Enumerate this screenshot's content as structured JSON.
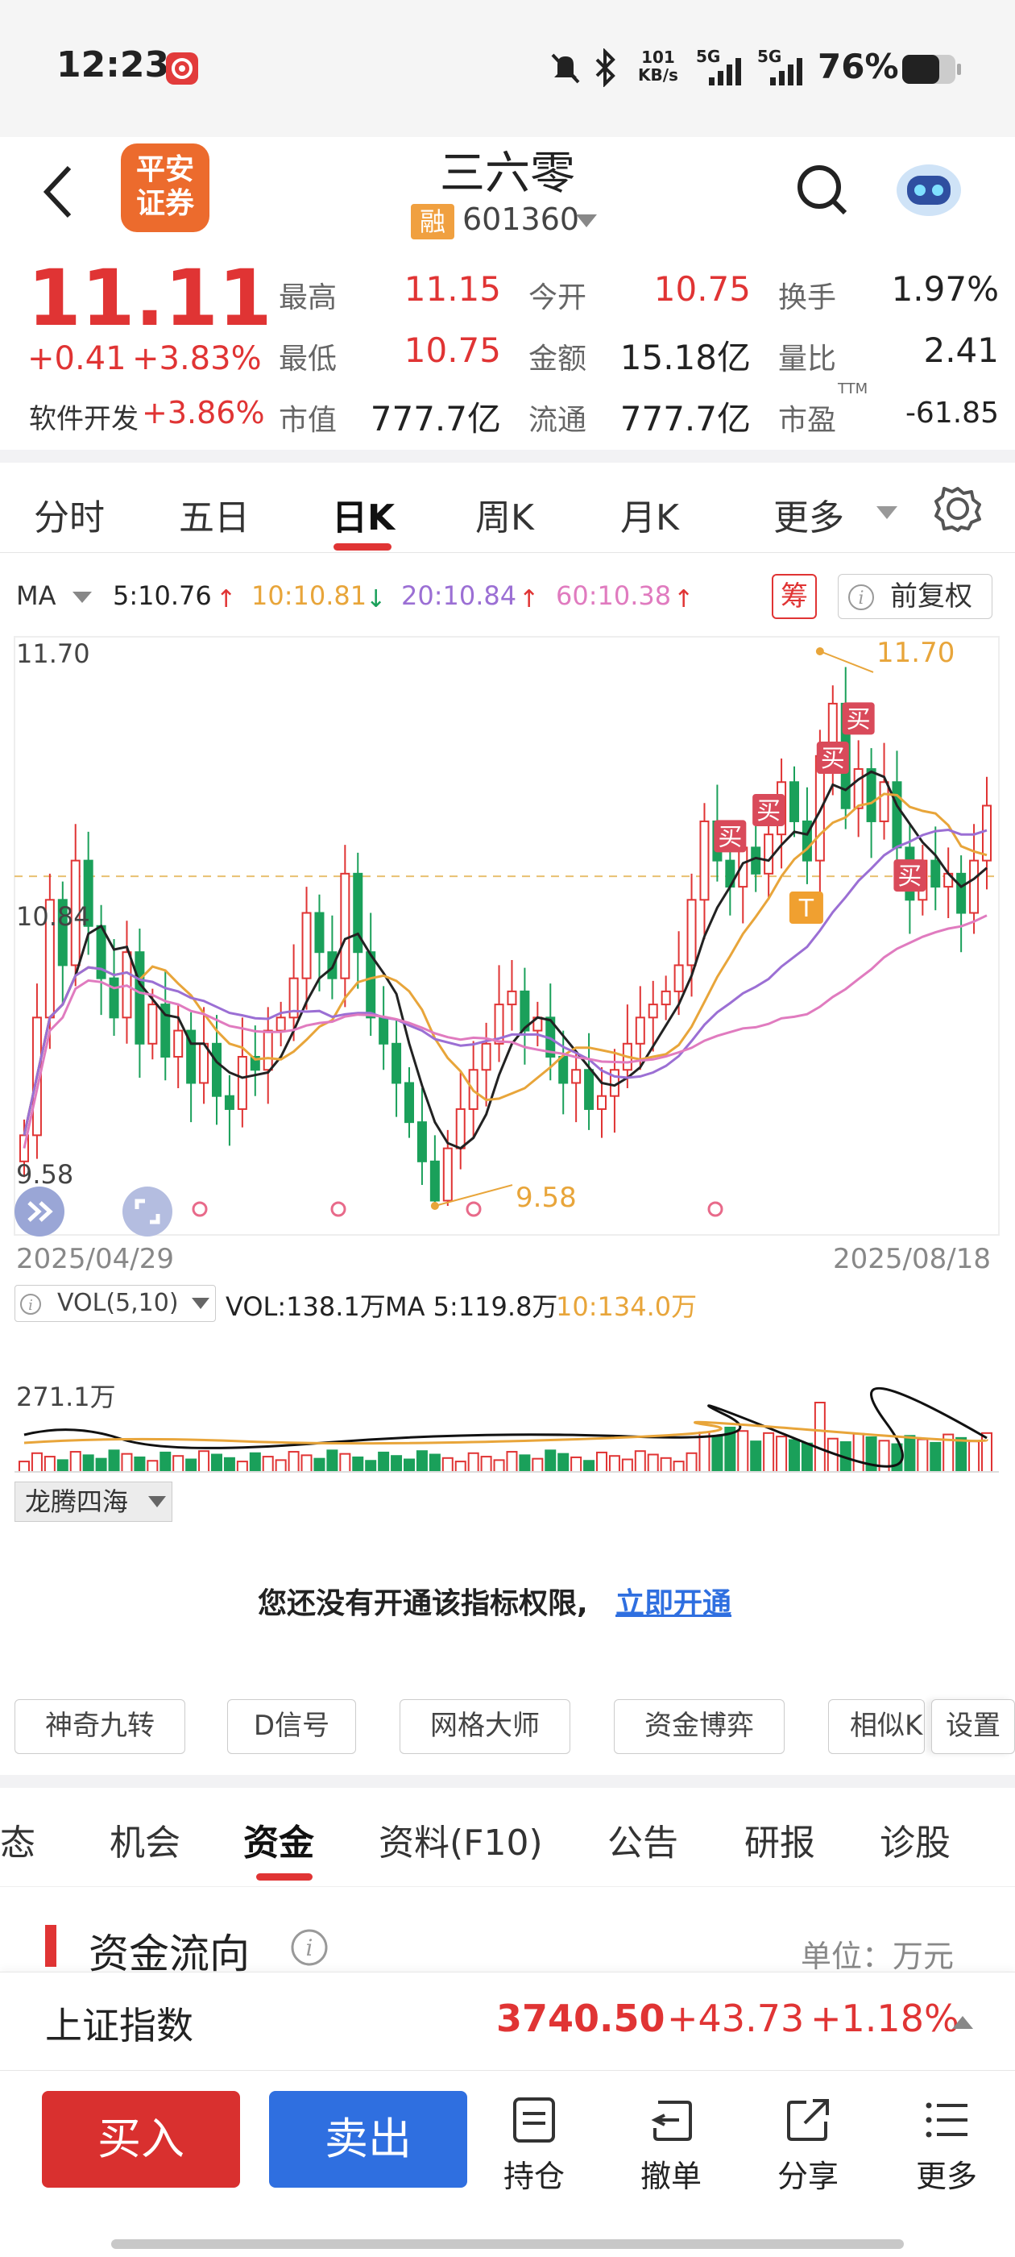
{
  "status": {
    "time": "12:23",
    "net_speed": "101",
    "net_unit": "KB/s",
    "sig1": "5G",
    "sig2": "5G",
    "battery": "76%"
  },
  "header": {
    "broker_line1": "平安",
    "broker_line2": "证券",
    "stock_name": "三六零",
    "margin_tag": "融",
    "code": "601360"
  },
  "quote": {
    "price": "11.11",
    "change": "+0.41",
    "change_pct": "+3.83%",
    "sector": "软件开发",
    "sector_pct": "+3.86%",
    "rows": [
      {
        "l1": "最高",
        "v1": "11.15",
        "l2": "今开",
        "v2": "10.75",
        "l3": "换手",
        "v3": "1.97%"
      },
      {
        "l1": "最低",
        "v1": "10.75",
        "l2": "金额",
        "v2": "15.18亿",
        "l3": "量比",
        "v3": "2.41"
      },
      {
        "l1": "市值",
        "v1": "777.7亿",
        "l2": "流通",
        "v2": "777.7亿",
        "l3": "市盈",
        "v3": "-61.85"
      }
    ],
    "ttm": "TTM"
  },
  "kline_tabs": [
    "分时",
    "五日",
    "日K",
    "周K",
    "月K",
    "更多"
  ],
  "ma": {
    "label": "MA",
    "ma5": "5:10.76",
    "ma10": "10:10.81",
    "ma20": "20:10.84",
    "ma60": "60:10.38",
    "chip": "筹",
    "adjust": "前复权",
    "colors": {
      "ma5": "#222222",
      "ma10": "#e8a53a",
      "ma20": "#9b6fd4",
      "ma60": "#e07bbf"
    }
  },
  "chart_data": {
    "type": "candlestick",
    "price_high_label": "11.70",
    "price_low_label": "9.58",
    "current_line": "10.84",
    "ylim": [
      9.58,
      11.7
    ],
    "max_annot": "11.70",
    "min_annot": "9.58",
    "date_start": "2025/04/29",
    "date_end": "2025/08/18",
    "markers": [
      "买",
      "买",
      "买",
      "买",
      "买",
      "T"
    ],
    "volume": {
      "label": "VOL(5,10)",
      "vol": "VOL:138.1万",
      "ma5": "MA 5:119.8万",
      "ma10": "10:134.0万",
      "max_label": "271.1万"
    }
  },
  "indicator": {
    "name": "龙腾四海",
    "notice": "您还没有开通该指标权限,",
    "link": "立即开通"
  },
  "tools": [
    "神奇九转",
    "D信号",
    "网格大师",
    "资金博弈",
    "相似K",
    "设置"
  ],
  "info_tabs": [
    "动态",
    "机会",
    "资金",
    "资料(F10)",
    "公告",
    "研报",
    "诊股"
  ],
  "fund": {
    "title": "资金流向",
    "unit": "单位：万元"
  },
  "index": {
    "name": "上证指数",
    "value": "3740.50",
    "change": "+43.73",
    "pct": "+1.18%"
  },
  "actions": {
    "buy": "买入",
    "sell": "卖出",
    "hold": "持仓",
    "cancel": "撤单",
    "share": "分享",
    "more": "更多"
  }
}
